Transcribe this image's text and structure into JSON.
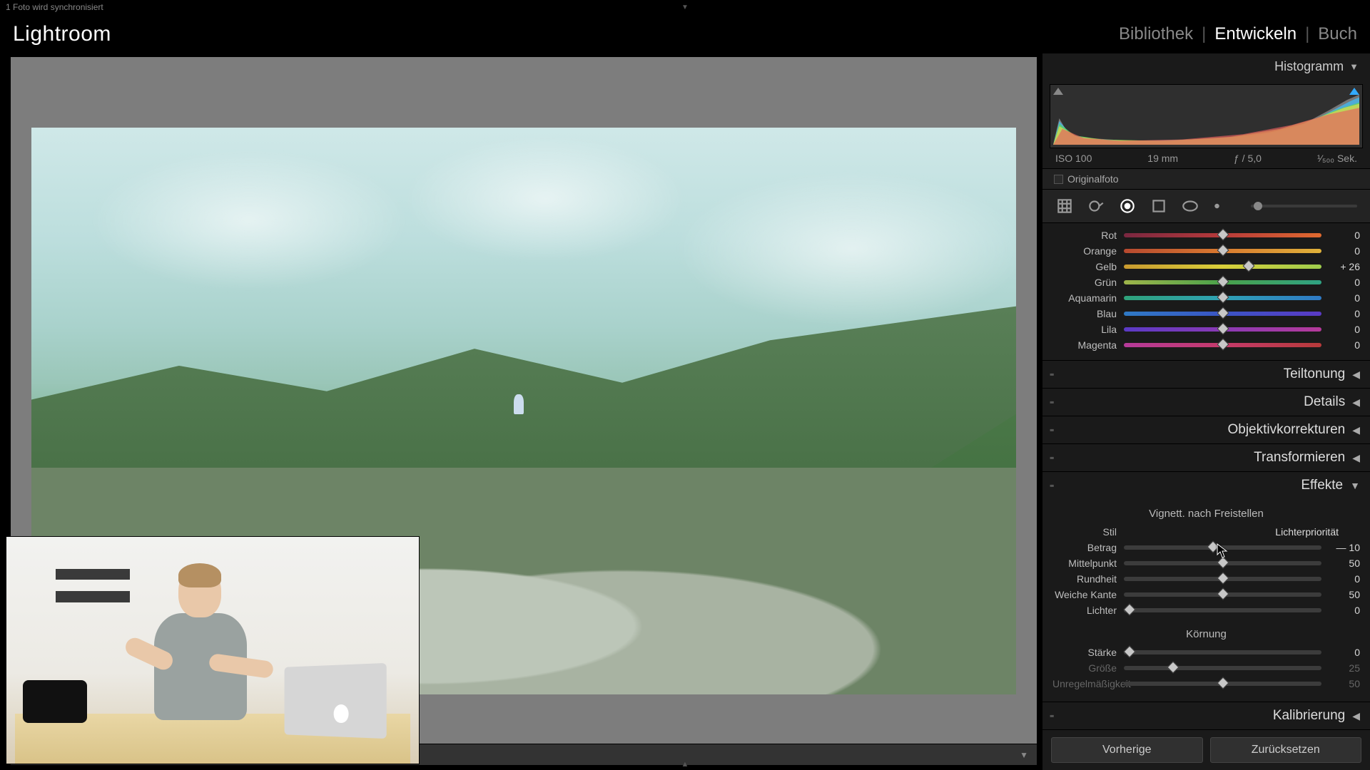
{
  "topbar": {
    "sync_text": "1 Foto wird synchronisiert"
  },
  "header": {
    "logo": "Lightroom",
    "nav": {
      "library": "Bibliothek",
      "develop": "Entwickeln",
      "book": "Buch"
    }
  },
  "histogram": {
    "title": "Histogramm",
    "meta": {
      "iso": "ISO 100",
      "focal": "19 mm",
      "aperture": "ƒ / 5,0",
      "shutter": "¹⁄₅₀₀ Sek."
    },
    "original_label": "Originalfoto",
    "original_checked": false
  },
  "hsl": {
    "rows": [
      {
        "label": "Rot",
        "value": "0",
        "pos": 50,
        "grad": [
          "#7a2740",
          "#b73a3a",
          "#e06a2f"
        ]
      },
      {
        "label": "Orange",
        "value": "0",
        "pos": 50,
        "grad": [
          "#b7492f",
          "#d97a2f",
          "#e0b23a"
        ]
      },
      {
        "label": "Gelb",
        "value": "+ 26",
        "pos": 63,
        "grad": [
          "#c99a2f",
          "#d9cf3a",
          "#9fce4d"
        ]
      },
      {
        "label": "Grün",
        "value": "0",
        "pos": 50,
        "grad": [
          "#9fb54a",
          "#4aa24a",
          "#2fa283"
        ]
      },
      {
        "label": "Aquamarin",
        "value": "0",
        "pos": 50,
        "grad": [
          "#2fa27a",
          "#2fa2b5",
          "#2f7ac5"
        ]
      },
      {
        "label": "Blau",
        "value": "0",
        "pos": 50,
        "grad": [
          "#2f7ac5",
          "#3a55c5",
          "#5a3ac5"
        ]
      },
      {
        "label": "Lila",
        "value": "0",
        "pos": 50,
        "grad": [
          "#5a3ac5",
          "#8a3ab5",
          "#b53a9a"
        ]
      },
      {
        "label": "Magenta",
        "value": "0",
        "pos": 50,
        "grad": [
          "#b53a9a",
          "#c53a6a",
          "#b73a3a"
        ]
      }
    ]
  },
  "sections": {
    "split": "Teiltonung",
    "detail": "Details",
    "lens": "Objektivkorrekturen",
    "transform": "Transformieren",
    "effects": "Effekte",
    "calibration": "Kalibrierung"
  },
  "effects": {
    "vignette_title": "Vignett. nach Freistellen",
    "style_label": "Stil",
    "style_value": "Lichterpriorität",
    "sliders": [
      {
        "label": "Betrag",
        "value": "— 10",
        "pos": 45,
        "dim": false
      },
      {
        "label": "Mittelpunkt",
        "value": "50",
        "pos": 50,
        "dim": false
      },
      {
        "label": "Rundheit",
        "value": "0",
        "pos": 50,
        "dim": false
      },
      {
        "label": "Weiche Kante",
        "value": "50",
        "pos": 50,
        "dim": false
      },
      {
        "label": "Lichter",
        "value": "0",
        "pos": 3,
        "dim": false
      }
    ],
    "grain_title": "Körnung",
    "grain_sliders": [
      {
        "label": "Stärke",
        "value": "0",
        "pos": 3,
        "dim": false
      },
      {
        "label": "Größe",
        "value": "25",
        "pos": 25,
        "dim": true
      },
      {
        "label": "Unregelmäßigkeit",
        "value": "50",
        "pos": 50,
        "dim": true
      }
    ]
  },
  "buttons": {
    "prev": "Vorherige",
    "reset": "Zurücksetzen"
  }
}
